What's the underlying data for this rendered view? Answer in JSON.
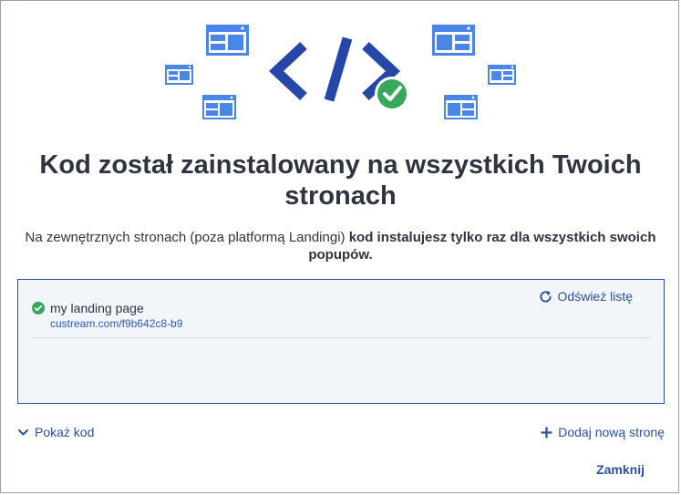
{
  "dialog": {
    "title": "Kod został zainstalowany na wszystkich Twoich stronach",
    "subtitle_regular": "Na zewnętrznych stronach (poza platformą Landingi) ",
    "subtitle_bold": "kod instalujesz tylko raz dla wszystkich swoich popupów."
  },
  "pages": {
    "refresh_label": "Odśwież listę",
    "items": [
      {
        "name": "my landing page",
        "url": "custream.com/f9b642c8-b9",
        "status": "installed"
      }
    ]
  },
  "footer": {
    "show_code_label": "Pokaż kod",
    "add_page_label": "Dodaj nową stronę",
    "close_label": "Zamknij"
  },
  "colors": {
    "brand_blue": "#2c4fa1",
    "icon_blue": "#4a86e8",
    "success_green": "#35a85a",
    "box_background": "#f2f5fa"
  },
  "icons": {
    "hero": "code-brackets-with-check-icon",
    "refresh": "refresh-icon",
    "show_code": "chevron-down-icon",
    "add_page": "plus-icon",
    "status": "check-circle-icon"
  }
}
